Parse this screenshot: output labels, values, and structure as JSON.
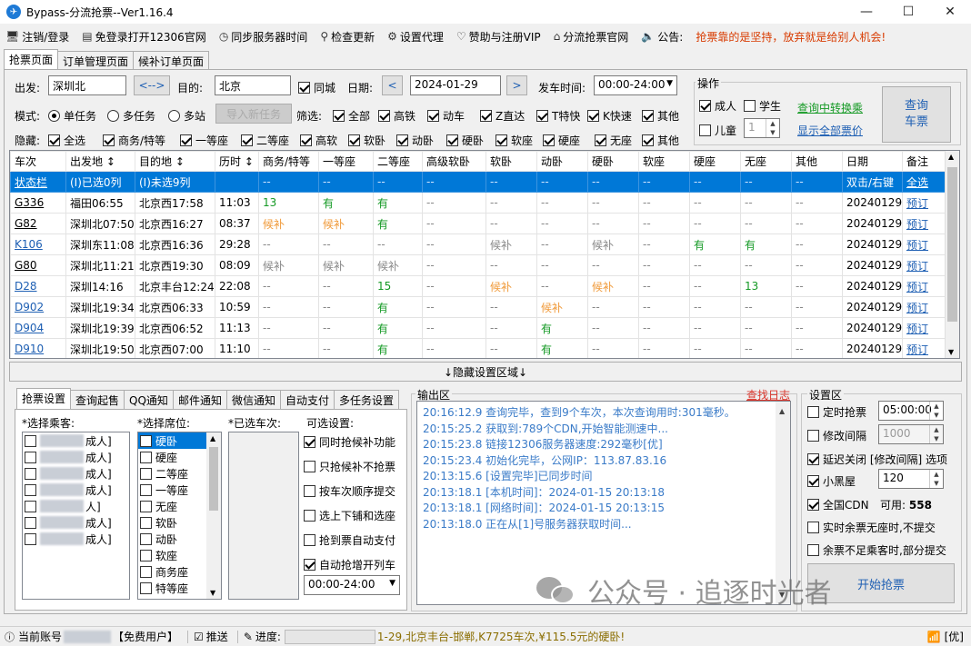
{
  "app": {
    "title": "Bypass-分流抢票--Ver1.16.4",
    "logo_glyph": "✈"
  },
  "window": {
    "minimize": "—",
    "maximize": "☐",
    "close": "✕"
  },
  "menu": [
    {
      "icon": "monitor-icon",
      "glyph": "🖥",
      "label": "注销/登录"
    },
    {
      "icon": "browser-icon",
      "glyph": "▤",
      "label": "免登录打开12306官网"
    },
    {
      "icon": "clock-icon",
      "glyph": "◷",
      "label": "同步服务器时间"
    },
    {
      "icon": "search-icon",
      "glyph": "⚲",
      "label": "检查更新"
    },
    {
      "icon": "gear-icon",
      "glyph": "⚙",
      "label": "设置代理"
    },
    {
      "icon": "heart-icon",
      "glyph": "♡",
      "label": "赞助与注册VIP"
    },
    {
      "icon": "home-icon",
      "glyph": "⌂",
      "label": "分流抢票官网"
    },
    {
      "icon": "speaker-icon",
      "glyph": "🔈",
      "label": "公告:"
    }
  ],
  "notice": "抢票靠的是坚持，放弃就是给别人机会!",
  "tabs": [
    "抢票页面",
    "订单管理页面",
    "候补订单页面"
  ],
  "query": {
    "from_label": "出发:",
    "from": "深圳北",
    "swap": "<-->",
    "to_label": "目的:",
    "to": "北京",
    "same_city": "同城",
    "date_label": "日期:",
    "date": "2024-01-29",
    "prev": "<",
    "next": ">",
    "time_label": "发车时间:",
    "time": "00:00-24:00"
  },
  "mode": {
    "label": "模式:",
    "options": [
      "单任务",
      "多任务",
      "多站"
    ],
    "import_btn": "导入新任务"
  },
  "filter": {
    "label": "筛选:",
    "options": [
      "全部",
      "高铁",
      "动车",
      "Z直达",
      "T特快",
      "K快速",
      "其他"
    ]
  },
  "hide": {
    "label": "隐藏:",
    "options": [
      "全选",
      "商务/特等",
      "一等座",
      "二等座",
      "高软",
      "软卧",
      "动卧",
      "硬卧",
      "软座",
      "硬座",
      "无座",
      "其他"
    ]
  },
  "ops": {
    "title": "操作",
    "adult": "成人",
    "student": "学生",
    "child": "儿童",
    "child_count": "1",
    "transfer_link": "查询中转换乘",
    "show_all_link": "显示全部票价",
    "query_btn1": "查询",
    "query_btn2": "车票"
  },
  "grid": {
    "headers": [
      "车次",
      "出发地 ↕",
      "目的地 ↕",
      "历时 ↕",
      "商务/特等",
      "一等座",
      "二等座",
      "高级软卧",
      "软卧",
      "动卧",
      "硬卧",
      "软座",
      "硬座",
      "无座",
      "其他",
      "日期",
      "备注"
    ],
    "rows": [
      [
        "状态栏",
        "(I)已选0列",
        "(I)未选9列",
        "",
        "--",
        "--",
        "--",
        "--",
        "--",
        "--",
        "--",
        "--",
        "--",
        "--",
        "--",
        "双击/右键",
        "全选"
      ],
      [
        "G336",
        "福田06:55",
        "北京西17:58",
        "11:03",
        "13",
        "有",
        "有",
        "--",
        "--",
        "--",
        "--",
        "--",
        "--",
        "--",
        "--",
        "20240129",
        "预订"
      ],
      [
        "G82",
        "深圳北07:50",
        "北京西16:27",
        "08:37",
        "候补",
        "候补",
        "有",
        "--",
        "--",
        "--",
        "--",
        "--",
        "--",
        "--",
        "--",
        "20240129",
        "预订"
      ],
      [
        "K106",
        "深圳东11:08",
        "北京西16:36",
        "29:28",
        "--",
        "--",
        "--",
        "--",
        "候补",
        "--",
        "候补",
        "--",
        "有",
        "有",
        "--",
        "20240129",
        "预订"
      ],
      [
        "G80",
        "深圳北11:21",
        "北京西19:30",
        "08:09",
        "候补",
        "候补",
        "候补",
        "--",
        "--",
        "--",
        "--",
        "--",
        "--",
        "--",
        "--",
        "20240129",
        "预订"
      ],
      [
        "D28",
        "深圳14:16",
        "北京丰台12:24",
        "22:08",
        "--",
        "--",
        "15",
        "--",
        "候补",
        "--",
        "候补",
        "--",
        "--",
        "13",
        "--",
        "20240129",
        "预订"
      ],
      [
        "D902",
        "深圳北19:34",
        "北京西06:33",
        "10:59",
        "--",
        "--",
        "有",
        "--",
        "--",
        "候补",
        "--",
        "--",
        "--",
        "--",
        "--",
        "20240129",
        "预订"
      ],
      [
        "D904",
        "深圳北19:39",
        "北京西06:52",
        "11:13",
        "--",
        "--",
        "有",
        "--",
        "--",
        "有",
        "--",
        "--",
        "--",
        "--",
        "--",
        "20240129",
        "预订"
      ],
      [
        "D910",
        "深圳北19:50",
        "北京西07:00",
        "11:10",
        "--",
        "--",
        "有",
        "--",
        "--",
        "有",
        "--",
        "--",
        "--",
        "--",
        "--",
        "20240129",
        "预订"
      ]
    ]
  },
  "toggle": "↓隐藏设置区域↓",
  "bottom_tabs": [
    "抢票设置",
    "查询起售",
    "QQ通知",
    "邮件通知",
    "微信通知",
    "自动支付",
    "多任务设置"
  ],
  "passengers": {
    "label": "*选择乘客:",
    "items": [
      "成人]",
      "成人]",
      "成人]",
      "成人]",
      "人]",
      "成人]",
      "成人]"
    ]
  },
  "seats": {
    "label": "*选择席位:",
    "items": [
      "硬卧",
      "硬座",
      "二等座",
      "一等座",
      "无座",
      "软卧",
      "动卧",
      "软座",
      "商务座",
      "特等座"
    ]
  },
  "chosen": {
    "label": "*已选车次:"
  },
  "settings": {
    "label": "可选设置:",
    "items": [
      "同时抢候补功能",
      "只抢候补不抢票",
      "按车次顺序提交",
      "选上下铺和选座",
      "抢到票自动支付",
      "自动抢增开列车"
    ],
    "time": "00:00-24:00"
  },
  "output": {
    "label": "输出区",
    "find_log": "查找日志",
    "lines": [
      "20:16:12.9  查询完毕，查到9个车次，本次查询用时:301毫秒。",
      "20:15:25.2  获取到:789个CDN,开始智能测速中...",
      "20:15:23.8  链接12306服务器速度:292毫秒[优]",
      "20:15:23.4  初始化完毕，公网IP：113.87.83.16",
      "20:13:15.6  [设置完毕]已同步时间",
      "20:13:18.1  [本机时间]：2024-01-15 20:13:18",
      "20:13:18.1  [网络时间]：2024-01-15 20:13:15",
      "20:13:18.0  正在从[1]号服务器获取时间..."
    ]
  },
  "setarea": {
    "label": "设置区",
    "timed": "定时抢票",
    "timed_val": "05:00:00",
    "interval": "修改间隔",
    "interval_val": "1000",
    "delay": "延迟关闭 [修改间隔] 选项",
    "blackroom": "小黑屋",
    "blackroom_val": "120",
    "cdn": "全国CDN",
    "cdn_avail_label": "可用:",
    "cdn_avail": "558",
    "realtime": "实时余票无座时,不提交",
    "partial": "余票不足乘客时,部分提交",
    "start_btn": "开始抢票"
  },
  "watermark": "公众号 · 追逐时光者",
  "status": {
    "account": "当前账号",
    "user_type": "【免费用户】",
    "push": "推送",
    "progress_label": "进度:",
    "scroll": "1-29,北京丰台-邯郸,K7725车次,¥115.5元的硬卧!",
    "net": "[优]"
  }
}
